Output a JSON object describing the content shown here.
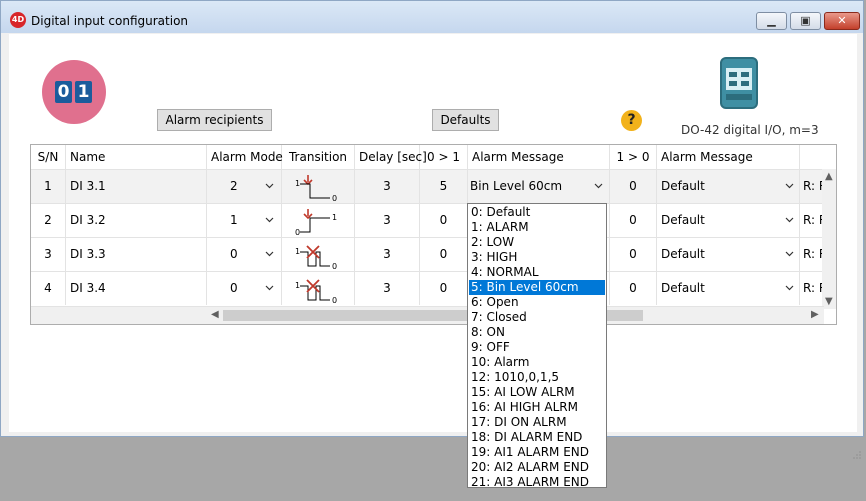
{
  "window": {
    "title": "Digital input configuration",
    "app_icon_text": "4D"
  },
  "logo_digits": [
    "0",
    "1"
  ],
  "buttons": {
    "alarm_recipients": "Alarm recipients",
    "defaults": "Defaults",
    "help": "?"
  },
  "device_label": "DO-42 digital I/O, m=3",
  "table": {
    "headers": {
      "sn": "S/N",
      "name": "Name",
      "alarm_mode": "Alarm Mode",
      "transition": "Transition",
      "delay": "Delay [sec]",
      "up": "0 > 1",
      "msg1": "Alarm Message",
      "down": "1 > 0",
      "msg2": "Alarm Message"
    },
    "rows": [
      {
        "sn": "1",
        "name": "DI 3.1",
        "mode": "2",
        "delay": "3",
        "up": "5",
        "msg1": "Bin Level 60cm",
        "down": "0",
        "msg2": "Default",
        "extra": "R: R"
      },
      {
        "sn": "2",
        "name": "DI 3.2",
        "mode": "1",
        "delay": "3",
        "up": "0",
        "msg1": "",
        "down": "0",
        "msg2": "Default",
        "extra": "R: R"
      },
      {
        "sn": "3",
        "name": "DI 3.3",
        "mode": "0",
        "delay": "3",
        "up": "0",
        "msg1": "",
        "down": "0",
        "msg2": "Default",
        "extra": "R: R"
      },
      {
        "sn": "4",
        "name": "DI 3.4",
        "mode": "0",
        "delay": "3",
        "up": "0",
        "msg1": "",
        "down": "0",
        "msg2": "Default",
        "extra": "R: R"
      }
    ]
  },
  "dropdown": {
    "options": [
      "0: Default",
      "1: ALARM",
      "2: LOW",
      "3: HIGH",
      "4: NORMAL",
      "5: Bin Level 60cm",
      "6: Open",
      "7: Closed",
      "8: ON",
      "9: OFF",
      "10: Alarm",
      "12: 1010,0,1,5",
      "15: AI LOW ALRM",
      "16: AI HIGH ALRM",
      "17: DI ON ALRM",
      "18: DI ALARM END",
      "19: AI1 ALARM END",
      "20: AI2 ALARM END",
      "21: AI3 ALARM END"
    ],
    "selected_index": 5
  },
  "colors": {
    "accent": "#0078d7",
    "logo": "#e0708e",
    "help": "#f2b21b"
  }
}
